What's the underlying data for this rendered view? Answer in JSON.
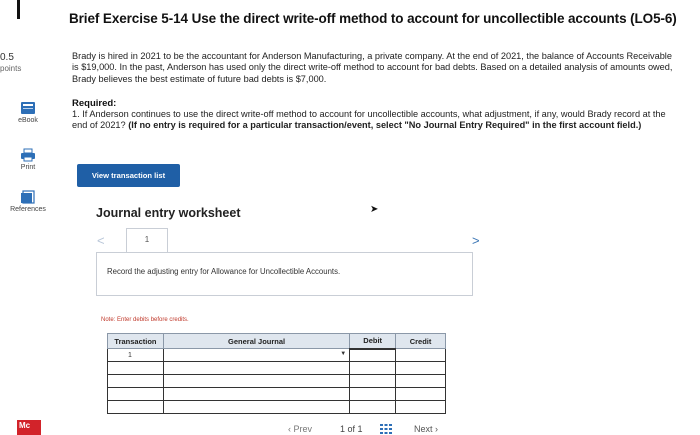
{
  "sidebar": {
    "points_value": "0.5",
    "points_label": "points",
    "tools": [
      {
        "label": "eBook",
        "icon": "book-icon"
      },
      {
        "label": "Print",
        "icon": "printer-icon"
      },
      {
        "label": "References",
        "icon": "references-icon"
      }
    ],
    "logo_text": "Mc"
  },
  "header": {
    "title": "Brief Exercise 5-14 Use the direct write-off method to account for uncollectible accounts (LO5-6)"
  },
  "problem": {
    "intro": "Brady is hired in 2021 to be the accountant for Anderson Manufacturing, a private company. At the end of 2021, the balance of Accounts Receivable is $19,000. In the past, Anderson has used only the direct write-off method to account for bad debts. Based on a detailed analysis of amounts owed, Brady believes the best estimate of future bad debts is $7,000.",
    "required_label": "Required:",
    "question": "1. If Anderson continues to use the direct write-off method to account for uncollectible accounts, what adjustment, if any, would Brady record at the end of 2021?",
    "hint": "(If no entry is required for a particular transaction/event, select \"No Journal Entry Required\" in the first account field.)"
  },
  "view_button_label": "View transaction list",
  "worksheet": {
    "title": "Journal entry worksheet",
    "tab_number": "1",
    "prompt": "Record the adjusting entry for Allowance for Uncollectible Accounts.",
    "note": "Note: Enter debits before credits.",
    "columns": [
      "Transaction",
      "General Journal",
      "Debit",
      "Credit"
    ],
    "rows": [
      {
        "transaction": "1"
      },
      {
        "transaction": ""
      },
      {
        "transaction": ""
      },
      {
        "transaction": ""
      },
      {
        "transaction": ""
      }
    ]
  },
  "pager": {
    "prev_label": "Prev",
    "count": "1 of 1",
    "next_label": "Next"
  },
  "colors": {
    "accent_button": "#1f5fa6",
    "table_header_bg": "#dfe6ee",
    "note_red": "#c0392b"
  }
}
